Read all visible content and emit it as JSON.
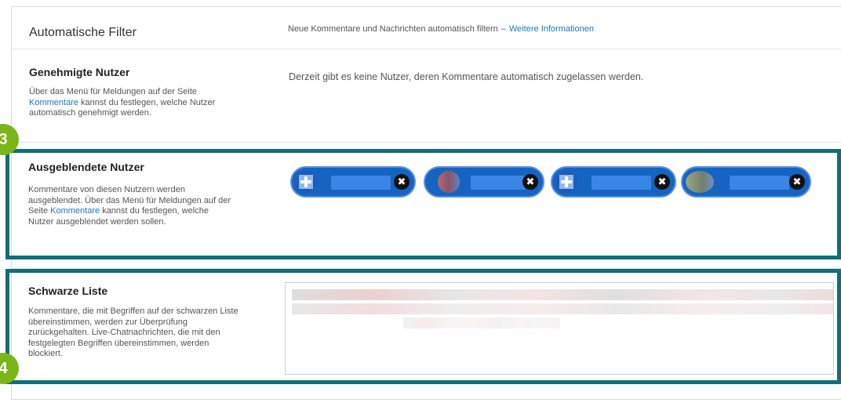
{
  "header": {
    "title": "Automatische Filter",
    "desc_prefix": "Neue Kommentare und Nachrichten automatisch filtern",
    "desc_sep": "–",
    "desc_link": "Weitere Informationen"
  },
  "approved_users": {
    "title": "Genehmigte Nutzer",
    "desc_before": "Über das Menü für Meldungen auf der Seite",
    "desc_link": "Kommentare",
    "desc_after": "kannst du festlegen, welche Nutzer automatisch genehmigt werden.",
    "empty_note": "Derzeit gibt es keine Nutzer, deren Kommentare automatisch zugelassen werden."
  },
  "hidden_users": {
    "title": "Ausgeblendete Nutzer",
    "desc_before": "Kommentare von diesen Nutzern werden ausgeblendet. Über das Menü für Meldungen auf der Seite",
    "desc_link": "Kommentare",
    "desc_after": "kannst du festlegen, welche Nutzer ausgeblendet werden sollen.",
    "chips": [
      {
        "avatar": "default-avatar-icon",
        "remove": "✖"
      },
      {
        "avatar": "photo-avatar",
        "remove": "✖"
      },
      {
        "avatar": "default-avatar-icon",
        "remove": "✖"
      },
      {
        "avatar": "photo-avatar",
        "remove": "✖"
      }
    ]
  },
  "blacklist": {
    "title": "Schwarze Liste",
    "desc": "Kommentare, die mit Begriffen auf der schwarzen Liste übereinstimmen, werden zur Überprüfung zurückgehalten. Live-Chatnachrichten, die mit den festgelegten Begriffen übereinstimmen, werden blockiert."
  },
  "badges": {
    "b3": "3",
    "b4": "4"
  },
  "colors": {
    "highlight": "#0e6f7a",
    "badge": "#7cb518",
    "link": "#167ac6",
    "chip": "#1565c0"
  }
}
